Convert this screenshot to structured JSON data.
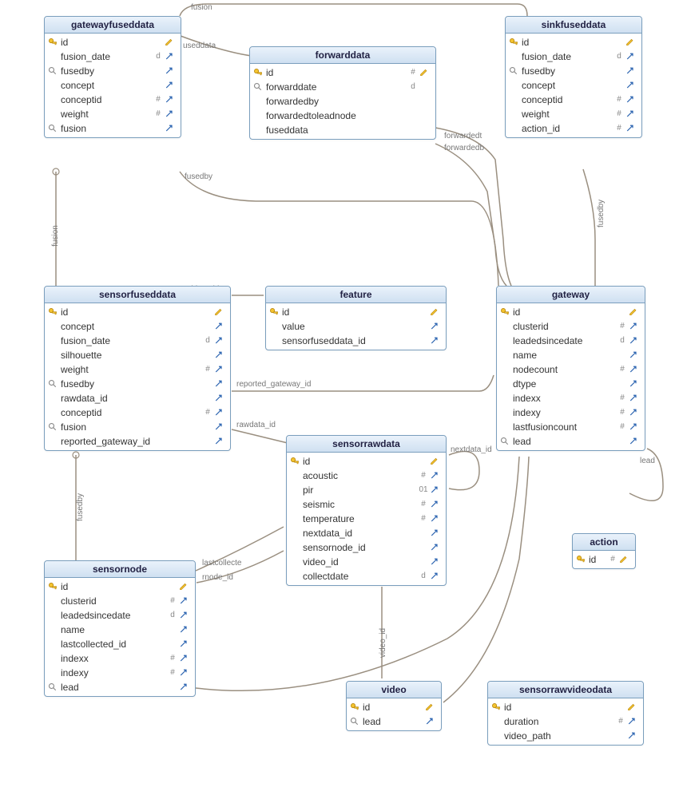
{
  "tables": {
    "gatewayfuseddata": {
      "title": "gatewayfuseddata",
      "cols": [
        {
          "icon": "key",
          "name": "id",
          "type": "",
          "edit": "pencil"
        },
        {
          "icon": "",
          "name": "fusion_date",
          "type": "d",
          "edit": "arrow"
        },
        {
          "icon": "lens",
          "name": "fusedby",
          "type": "",
          "edit": "arrow"
        },
        {
          "icon": "",
          "name": "concept",
          "type": "",
          "edit": "arrow"
        },
        {
          "icon": "",
          "name": "conceptid",
          "type": "#",
          "edit": "arrow"
        },
        {
          "icon": "",
          "name": "weight",
          "type": "#",
          "edit": "arrow"
        },
        {
          "icon": "lens",
          "name": "fusion",
          "type": "",
          "edit": "arrow"
        }
      ]
    },
    "forwarddata": {
      "title": "forwarddata",
      "cols": [
        {
          "icon": "key",
          "name": "id",
          "type": "#",
          "edit": "pencil"
        },
        {
          "icon": "lens",
          "name": "forwarddate",
          "type": "d",
          "edit": ""
        },
        {
          "icon": "",
          "name": "forwardedby",
          "type": "",
          "edit": ""
        },
        {
          "icon": "",
          "name": "forwardedtoleadnode",
          "type": "",
          "edit": ""
        },
        {
          "icon": "",
          "name": "fuseddata",
          "type": "",
          "edit": ""
        }
      ]
    },
    "sinkfuseddata": {
      "title": "sinkfuseddata",
      "cols": [
        {
          "icon": "key",
          "name": "id",
          "type": "",
          "edit": "pencil"
        },
        {
          "icon": "",
          "name": "fusion_date",
          "type": "d",
          "edit": "arrow"
        },
        {
          "icon": "lens",
          "name": "fusedby",
          "type": "",
          "edit": "arrow"
        },
        {
          "icon": "",
          "name": "concept",
          "type": "",
          "edit": "arrow"
        },
        {
          "icon": "",
          "name": "conceptid",
          "type": "#",
          "edit": "arrow"
        },
        {
          "icon": "",
          "name": "weight",
          "type": "#",
          "edit": "arrow"
        },
        {
          "icon": "",
          "name": "action_id",
          "type": "#",
          "edit": "arrow"
        }
      ]
    },
    "sensorfuseddata": {
      "title": "sensorfuseddata",
      "cols": [
        {
          "icon": "key",
          "name": "id",
          "type": "",
          "edit": "pencil"
        },
        {
          "icon": "",
          "name": "concept",
          "type": "",
          "edit": "arrow"
        },
        {
          "icon": "",
          "name": "fusion_date",
          "type": "d",
          "edit": "arrow"
        },
        {
          "icon": "",
          "name": "silhouette",
          "type": "",
          "edit": "arrow"
        },
        {
          "icon": "",
          "name": "weight",
          "type": "#",
          "edit": "arrow"
        },
        {
          "icon": "lens",
          "name": "fusedby",
          "type": "",
          "edit": "arrow"
        },
        {
          "icon": "",
          "name": "rawdata_id",
          "type": "",
          "edit": "arrow"
        },
        {
          "icon": "",
          "name": "conceptid",
          "type": "#",
          "edit": "arrow"
        },
        {
          "icon": "lens",
          "name": "fusion",
          "type": "",
          "edit": "arrow"
        },
        {
          "icon": "",
          "name": "reported_gateway_id",
          "type": "",
          "edit": "arrow"
        }
      ]
    },
    "feature": {
      "title": "feature",
      "cols": [
        {
          "icon": "key",
          "name": "id",
          "type": "",
          "edit": "pencil"
        },
        {
          "icon": "",
          "name": "value",
          "type": "",
          "edit": "arrow"
        },
        {
          "icon": "",
          "name": "sensorfuseddata_id",
          "type": "",
          "edit": "arrow"
        }
      ]
    },
    "gateway": {
      "title": "gateway",
      "cols": [
        {
          "icon": "key",
          "name": "id",
          "type": "",
          "edit": "pencil"
        },
        {
          "icon": "",
          "name": "clusterid",
          "type": "#",
          "edit": "arrow"
        },
        {
          "icon": "",
          "name": "leadedsincedate",
          "type": "d",
          "edit": "arrow"
        },
        {
          "icon": "",
          "name": "name",
          "type": "",
          "edit": "arrow"
        },
        {
          "icon": "",
          "name": "nodecount",
          "type": "#",
          "edit": "arrow"
        },
        {
          "icon": "",
          "name": "dtype",
          "type": "",
          "edit": "arrow"
        },
        {
          "icon": "",
          "name": "indexx",
          "type": "#",
          "edit": "arrow"
        },
        {
          "icon": "",
          "name": "indexy",
          "type": "#",
          "edit": "arrow"
        },
        {
          "icon": "",
          "name": "lastfusioncount",
          "type": "#",
          "edit": "arrow"
        },
        {
          "icon": "lens",
          "name": "lead",
          "type": "",
          "edit": "arrow"
        }
      ]
    },
    "sensorrawdata": {
      "title": "sensorrawdata",
      "cols": [
        {
          "icon": "key",
          "name": "id",
          "type": "",
          "edit": "pencil"
        },
        {
          "icon": "",
          "name": "acoustic",
          "type": "#",
          "edit": "arrow"
        },
        {
          "icon": "",
          "name": "pir",
          "type": "01",
          "edit": "arrow"
        },
        {
          "icon": "",
          "name": "seismic",
          "type": "#",
          "edit": "arrow"
        },
        {
          "icon": "",
          "name": "temperature",
          "type": "#",
          "edit": "arrow"
        },
        {
          "icon": "",
          "name": "nextdata_id",
          "type": "",
          "edit": "arrow"
        },
        {
          "icon": "",
          "name": "sensornode_id",
          "type": "",
          "edit": "arrow"
        },
        {
          "icon": "",
          "name": "video_id",
          "type": "",
          "edit": "arrow"
        },
        {
          "icon": "",
          "name": "collectdate",
          "type": "d",
          "edit": "arrow"
        }
      ]
    },
    "sensornode": {
      "title": "sensornode",
      "cols": [
        {
          "icon": "key",
          "name": "id",
          "type": "",
          "edit": "pencil"
        },
        {
          "icon": "",
          "name": "clusterid",
          "type": "#",
          "edit": "arrow"
        },
        {
          "icon": "",
          "name": "leadedsincedate",
          "type": "d",
          "edit": "arrow"
        },
        {
          "icon": "",
          "name": "name",
          "type": "",
          "edit": "arrow"
        },
        {
          "icon": "",
          "name": "lastcollected_id",
          "type": "",
          "edit": "arrow"
        },
        {
          "icon": "",
          "name": "indexx",
          "type": "#",
          "edit": "arrow"
        },
        {
          "icon": "",
          "name": "indexy",
          "type": "#",
          "edit": "arrow"
        },
        {
          "icon": "lens",
          "name": "lead",
          "type": "",
          "edit": "arrow"
        }
      ]
    },
    "video": {
      "title": "video",
      "cols": [
        {
          "icon": "key",
          "name": "id",
          "type": "",
          "edit": "pencil"
        },
        {
          "icon": "lens",
          "name": "lead",
          "type": "",
          "edit": "arrow"
        }
      ]
    },
    "action": {
      "title": "action",
      "cols": [
        {
          "icon": "key",
          "name": "id",
          "type": "#",
          "edit": "pencil"
        }
      ]
    },
    "sensorrawvideodata": {
      "title": "sensorrawvideodata",
      "cols": [
        {
          "icon": "key",
          "name": "id",
          "type": "",
          "edit": "pencil"
        },
        {
          "icon": "",
          "name": "duration",
          "type": "#",
          "edit": "arrow"
        },
        {
          "icon": "",
          "name": "video_path",
          "type": "",
          "edit": "arrow"
        }
      ]
    }
  },
  "labels": {
    "fusion": "fusion",
    "useddata": "useddata",
    "fusedby": "fusedby",
    "ddata_id": "ddata_id",
    "rawdata_id": "rawdata_id",
    "reported_gateway_id": "reported_gateway_id",
    "nextdata_id": "nextdata_id",
    "lastcollecte": "lastcollecte",
    "rnode_id": "rnode_id",
    "video_id": "video_id",
    "forwardedt": "forwardedt",
    "forwardedb": "forwardedb",
    "lead": "lead"
  }
}
